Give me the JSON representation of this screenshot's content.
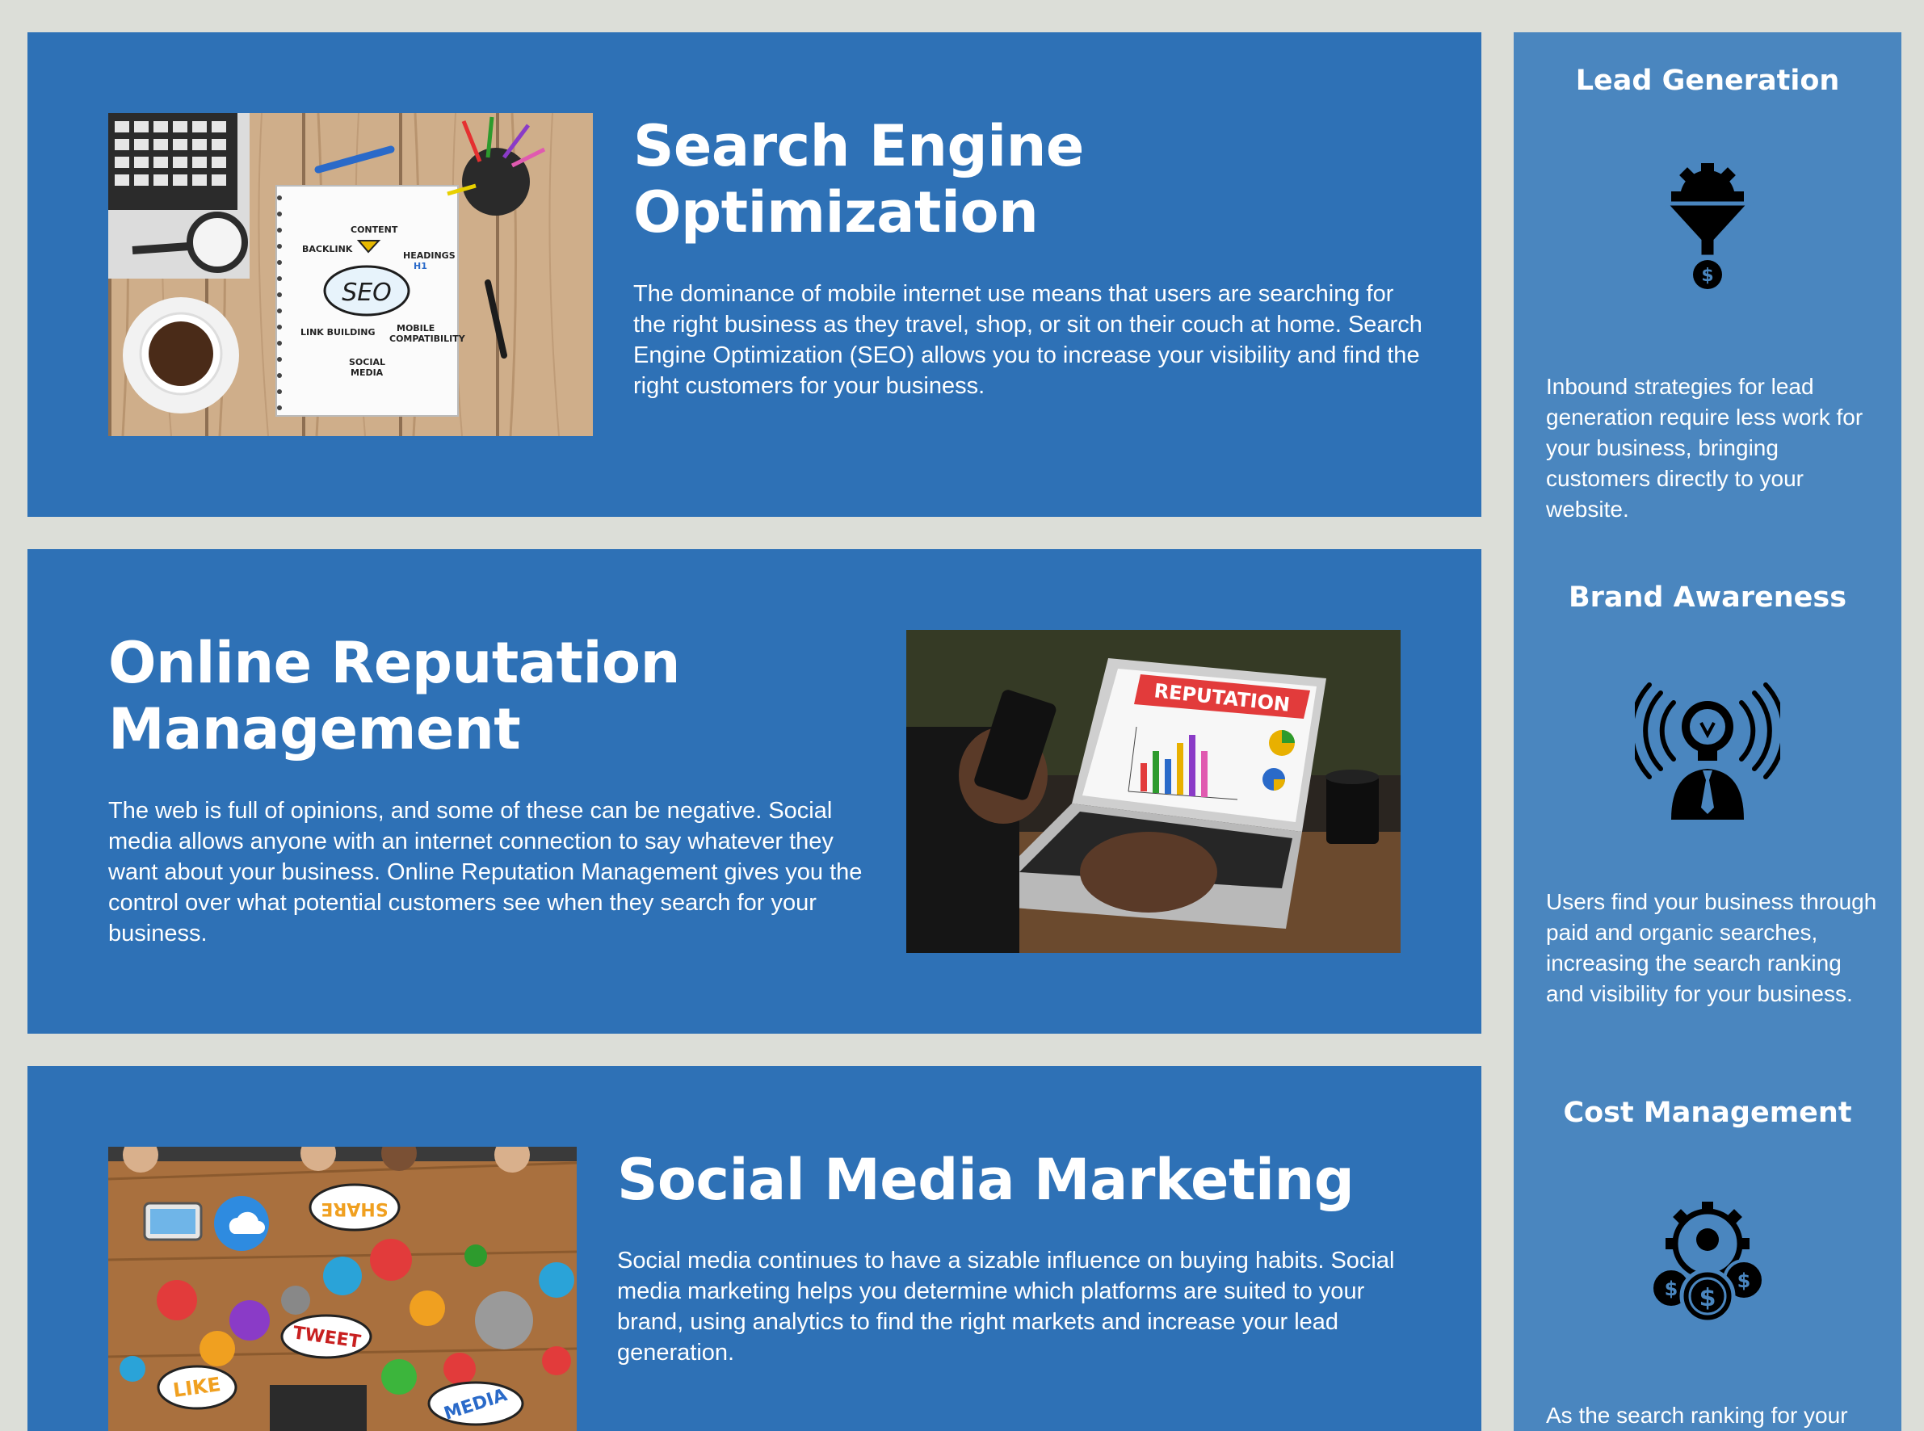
{
  "sections": [
    {
      "title_line1": "Search Engine",
      "title_line2": "Optimization",
      "body": "The dominance of mobile internet use means that users are searching for the right business as they travel, shop, or sit on their couch at home. Search Engine Optimization (SEO) allows you to increase your visibility and find the right customers for your business.",
      "photo_words": [
        "SEO",
        "BACKLINK",
        "CONTENT",
        "HEADINGS",
        "H1",
        "LINK BUILDING",
        "MOBILE",
        "COMPATIBILITY",
        "SOCIAL",
        "MEDIA"
      ]
    },
    {
      "title_line1": "Online Reputation",
      "title_line2": "Management",
      "body": "The web is full of opinions, and some of these can be negative. Social media allows anyone with an internet connection to say whatever they want about your business. Online Reputation Management gives you the control over what potential customers see when they search for your business.",
      "photo_words": [
        "REPUTATION"
      ]
    },
    {
      "title": "Social Media Marketing",
      "body": "Social media continues to have a sizable influence on buying habits. Social media marketing helps you determine which platforms are suited to your brand, using analytics to find the right markets and increase your lead generation.",
      "photo_words": [
        "SHARE",
        "TWEET",
        "LIKE",
        "MEDIA"
      ]
    }
  ],
  "sidebar": {
    "items": [
      {
        "title": "Lead Generation",
        "icon": "funnel-gear-dollar-icon",
        "text": "Inbound strategies for lead generation require less work for your business, bringing customers directly to your website."
      },
      {
        "title": "Brand Awareness",
        "icon": "lightbulb-person-broadcast-icon",
        "text": "Users find your business through paid and organic searches, increasing the search ranking and visibility for your business."
      },
      {
        "title": "Cost Management",
        "icon": "gear-person-coins-icon",
        "text": "As the search ranking for your"
      }
    ]
  },
  "colors": {
    "page_bg": "#dcded8",
    "card_bg": "#2e71b6",
    "sidebar_bg": "#4a86bf",
    "text": "#ffffff",
    "icon": "#000000"
  }
}
